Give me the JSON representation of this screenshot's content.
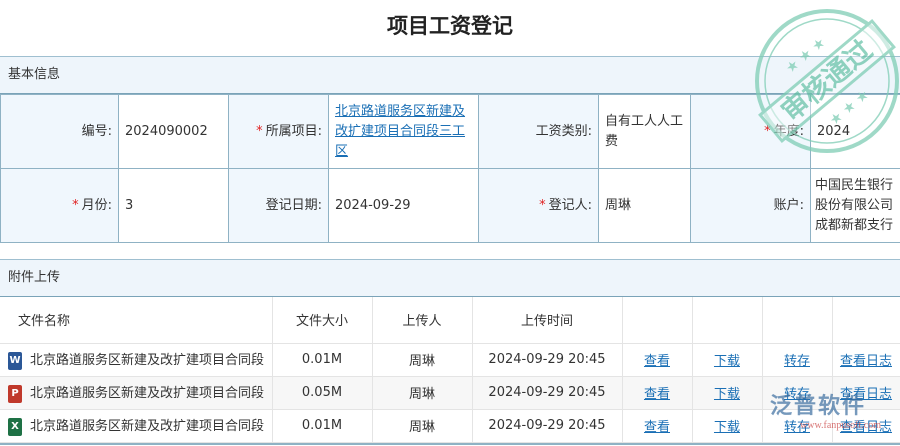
{
  "title": "项目工资登记",
  "basic_section": "基本信息",
  "form": {
    "row1": [
      {
        "label": "编号:",
        "required": false,
        "value": "2024090002"
      },
      {
        "label": "所属项目:",
        "required": true,
        "value": "北京路道服务区新建及改扩建项目合同段三工区",
        "link": true
      },
      {
        "label": "工资类别:",
        "required": false,
        "value": "自有工人人工费"
      },
      {
        "label": "年度:",
        "required": true,
        "value": "2024"
      }
    ],
    "row2": [
      {
        "label": "月份:",
        "required": true,
        "value": "3"
      },
      {
        "label": "登记日期:",
        "required": false,
        "value": "2024-09-29"
      },
      {
        "label": "登记人:",
        "required": true,
        "value": "周琳"
      },
      {
        "label": "账户:",
        "required": false,
        "value": "中国民生银行股份有限公司成都新都支行"
      }
    ]
  },
  "attach_section": "附件上传",
  "files": {
    "headers": [
      "文件名称",
      "文件大小",
      "上传人",
      "上传时间"
    ],
    "actions": [
      "查看",
      "下载",
      "转存",
      "查看日志"
    ],
    "rows": [
      {
        "type": "word",
        "icon_letter": "W",
        "name": "北京路道服务区新建及改扩建项目合同段",
        "size": "0.01M",
        "uploader": "周琳",
        "time": "2024-09-29 20:45"
      },
      {
        "type": "powerpoint",
        "icon_letter": "P",
        "name": "北京路道服务区新建及改扩建项目合同段",
        "size": "0.05M",
        "uploader": "周琳",
        "time": "2024-09-29 20:45"
      },
      {
        "type": "excel",
        "icon_letter": "X",
        "name": "北京路道服务区新建及改扩建项目合同段",
        "size": "0.01M",
        "uploader": "周琳",
        "time": "2024-09-29 20:45"
      }
    ]
  },
  "stamp": "审核通过",
  "watermark": {
    "brand": "泛普软件",
    "url": "www.fanpusoft.com"
  },
  "colors": {
    "link": "#1a6fb5",
    "required": "#e02020",
    "word": "#2b5797",
    "powerpoint": "#c0392b",
    "excel": "#1e7145",
    "stamp": "#7fcdb5"
  }
}
